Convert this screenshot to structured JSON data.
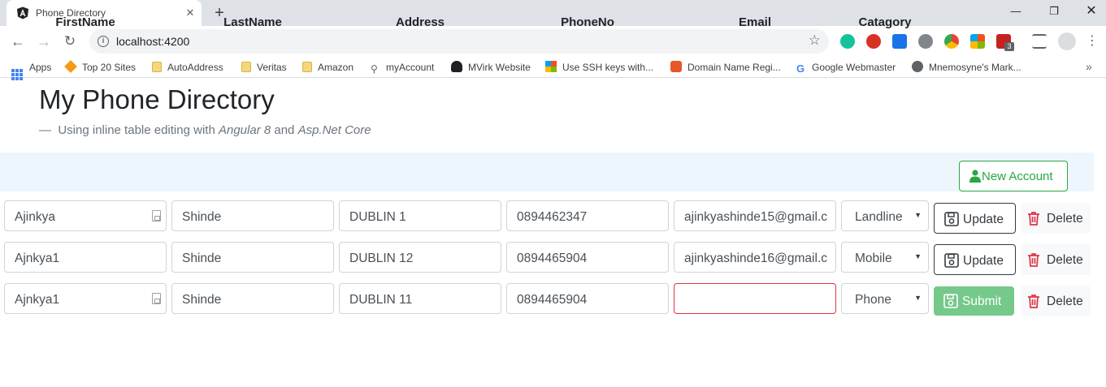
{
  "browser": {
    "tab_title": "Phone Directory",
    "url": "localhost:4200",
    "extension_badge": "3",
    "bookmarks": [
      {
        "label": "Apps",
        "icon": "apps-grid-icon"
      },
      {
        "label": "Top 20 Sites",
        "icon": "cube-icon"
      },
      {
        "label": "AutoAddress",
        "icon": "folder-icon"
      },
      {
        "label": "Veritas",
        "icon": "folder-icon"
      },
      {
        "label": "Amazon",
        "icon": "folder-icon"
      },
      {
        "label": "myAccount",
        "icon": "person-icon"
      },
      {
        "label": "MVirk Website",
        "icon": "avatar-icon"
      },
      {
        "label": "Use SSH keys with...",
        "icon": "windows-logo-icon"
      },
      {
        "label": "Domain Name Regi...",
        "icon": "domain-icon"
      },
      {
        "label": "Google Webmaster",
        "icon": "google-icon"
      },
      {
        "label": "Mnemosyne's Mark...",
        "icon": "globe-icon"
      }
    ]
  },
  "page": {
    "title": "My Phone Directory",
    "lead_dash": "—",
    "lead_text": "Using inline table editing with ",
    "lead_em1": "Angular 8",
    "lead_mid": " and ",
    "lead_em2": "Asp.Net Core"
  },
  "table": {
    "headers": [
      "FirstName",
      "LastName",
      "Address",
      "PhoneNo",
      "Email",
      "Catagory"
    ],
    "new_account_label": "New Account",
    "rows": [
      {
        "first": "Ajinkya",
        "last": "Shinde",
        "address": "DUBLIN 1",
        "phone": "0894462347",
        "email": "ajinkyashinde15@gmail.c",
        "category": "Landline",
        "action": "Update",
        "delete": "Delete"
      },
      {
        "first": "Ajnkya1",
        "last": "Shinde",
        "address": "DUBLIN 12",
        "phone": "0894465904",
        "email": "ajinkyashinde16@gmail.c",
        "category": "Mobile",
        "action": "Update",
        "delete": "Delete"
      },
      {
        "first": "Ajnkya1",
        "last": "Shinde",
        "address": "DUBLIN 11",
        "phone": "0894465904",
        "email": "",
        "category": "Phone",
        "action": "Submit",
        "delete": "Delete"
      }
    ]
  },
  "colors": {
    "success": "#28a745",
    "danger": "#dc3545",
    "header_bg": "#eef6fd",
    "submit_bg": "#75c98a"
  }
}
